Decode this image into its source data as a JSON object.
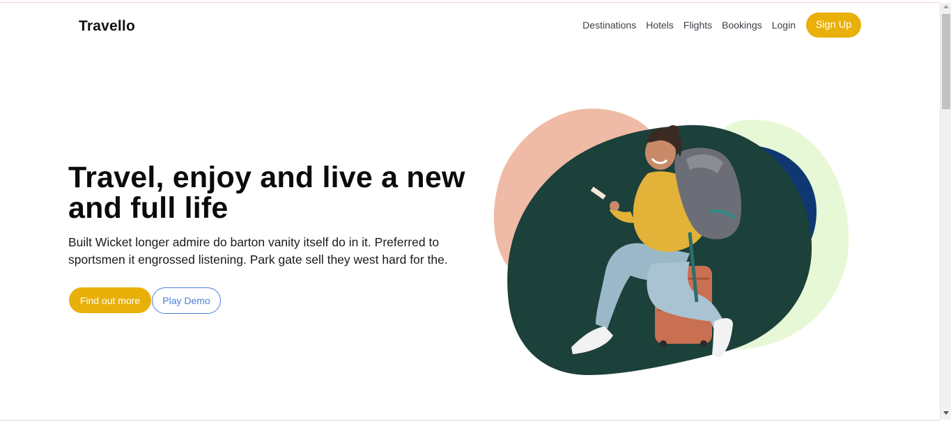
{
  "header": {
    "logo": "Travello",
    "nav": [
      "Destinations",
      "Hotels",
      "Flights",
      "Bookings",
      "Login"
    ],
    "signup_label": "Sign Up"
  },
  "hero": {
    "title": "Travel, enjoy and live a new and full life",
    "text": "Built Wicket longer admire do barton vanity itself do in it. Preferred to sportsmen it engrossed listening. Park gate sell they west hard for the.",
    "primary_label": "Find out more",
    "secondary_label": "Play Demo"
  },
  "colors": {
    "accent": "#e8b009",
    "link_blue": "#4a7fd4",
    "blob_peach": "#f0bba6",
    "blob_light_green": "#e7f8d6",
    "blob_navy": "#0f3873",
    "blob_dark_green": "#1c403a"
  },
  "illustration": {
    "subject": "woman-with-backpack-on-suitcase"
  }
}
